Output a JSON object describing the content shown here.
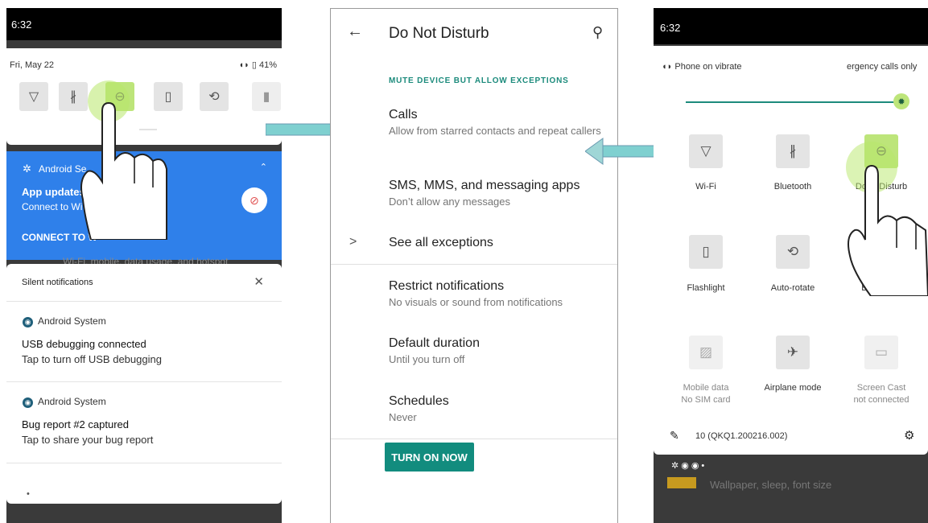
{
  "panel1": {
    "status_time": "6:32",
    "date": "Fri, May 22",
    "battery": "41%",
    "notification_blue": {
      "app": "Android Se",
      "title": "App updates a",
      "text": "Connect to Wi",
      "action": "CONNECT TO W",
      "behind_text": "Wi-Fi, mobile, data usage, and hotspot"
    },
    "silent": {
      "header": "Silent notifications",
      "items": [
        {
          "app": "Android System",
          "title": "USB debugging connected",
          "text": "Tap to turn off USB debugging"
        },
        {
          "app": "Android System",
          "title": "Bug report #2 captured",
          "text": "Tap to share your bug report"
        }
      ],
      "more": "•"
    }
  },
  "panel2": {
    "title": "Do Not Disturb",
    "section": "MUTE DEVICE BUT ALLOW EXCEPTIONS",
    "items": [
      {
        "title": "Calls",
        "subtitle": "Allow from starred contacts and repeat callers"
      },
      {
        "title": "SMS, MMS, and messaging apps",
        "subtitle": "Don’t allow any messages"
      },
      {
        "title": "See all exceptions",
        "subtitle": ""
      },
      {
        "title": "Restrict notifications",
        "subtitle": "No visuals or sound from notifications"
      },
      {
        "title": "Default duration",
        "subtitle": "Until you turn off"
      },
      {
        "title": "Schedules",
        "subtitle": "Never"
      }
    ],
    "button": "TURN ON NOW"
  },
  "panel3": {
    "status_time": "6:32",
    "vibrate": "Phone on vibrate",
    "emergency": "ergency calls only",
    "tiles": [
      {
        "label": "Wi-Fi",
        "icon": "wifi-icon"
      },
      {
        "label": "Bluetooth",
        "icon": "bluetooth-icon"
      },
      {
        "label": "Do     Disturb",
        "icon": "dnd-icon"
      },
      {
        "label": "Flashlight",
        "icon": "flashlight-icon"
      },
      {
        "label": "Auto-rotate",
        "icon": "rotate-icon"
      },
      {
        "label": "Ba",
        "icon": "battery-icon"
      },
      {
        "label": "Mobile data",
        "sub": "No SIM card",
        "icon": "mobile-data-icon"
      },
      {
        "label": "Airplane mode",
        "icon": "airplane-icon"
      },
      {
        "label": "Screen Cast",
        "sub": "not connected",
        "icon": "cast-icon"
      }
    ],
    "build": "10 (QKQ1.200216.002)",
    "behind_text": "Wallpaper, sleep, font size"
  }
}
